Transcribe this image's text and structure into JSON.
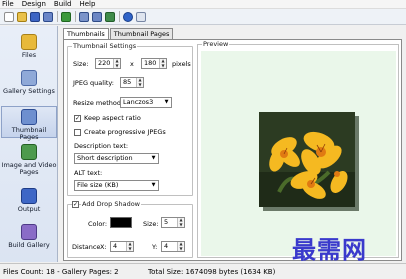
{
  "menu": [
    "File",
    "Design",
    "Build",
    "Help"
  ],
  "toolbar": {
    "icons": [
      "new-icon",
      "open-icon",
      "save-icon",
      "save-as-icon",
      "refresh-icon",
      "thumbnails-icon",
      "layout-icon",
      "export-icon",
      "help-icon",
      "info-icon"
    ]
  },
  "sidebar": {
    "items": [
      {
        "label": "Files",
        "icon": "folder-icon"
      },
      {
        "label": "Gallery Settings",
        "icon": "settings-icon"
      },
      {
        "label": "Thumbnail Pages",
        "icon": "thumbnail-pages-icon"
      },
      {
        "label": "Image and Video Pages",
        "icon": "image-video-icon"
      },
      {
        "label": "Output",
        "icon": "output-icon"
      },
      {
        "label": "Build Gallery",
        "icon": "build-icon"
      }
    ],
    "active_index": 2
  },
  "tabs": [
    "Thumbnails",
    "Thumbnail Pages"
  ],
  "active_tab": 0,
  "thumbnail_settings": {
    "title": "Thumbnail Settings",
    "size_label": "Size:",
    "width": "220",
    "x_label": "x",
    "height": "180",
    "pixels_label": "pixels",
    "jpeg_quality_label": "JPEG quality:",
    "jpeg_quality": "85",
    "resize_method_label": "Resize method:",
    "resize_method": "Lanczos3",
    "keep_aspect_ratio_label": "Keep aspect ratio",
    "keep_aspect_ratio": true,
    "create_progressive_label": "Create progressive JPEGs",
    "create_progressive": false,
    "description_text_label": "Description text:",
    "description_text": "Short description",
    "alt_text_label": "ALT text:",
    "alt_text": "File size (KB)"
  },
  "drop_shadow": {
    "title": "Add Drop Shadow",
    "enabled": true,
    "color_label": "Color:",
    "color": "#000000",
    "size_label": "Size:",
    "size": "5",
    "distance_label": "Distance",
    "x_label": "X:",
    "x": "4",
    "y_label": "Y:",
    "y": "4"
  },
  "preview": {
    "title": "Preview"
  },
  "status": {
    "files": "Files Count: 18 - Gallery Pages: 2",
    "total_size": "Total Size: 1674098 bytes (1634 KB)"
  },
  "watermark": "最需网"
}
